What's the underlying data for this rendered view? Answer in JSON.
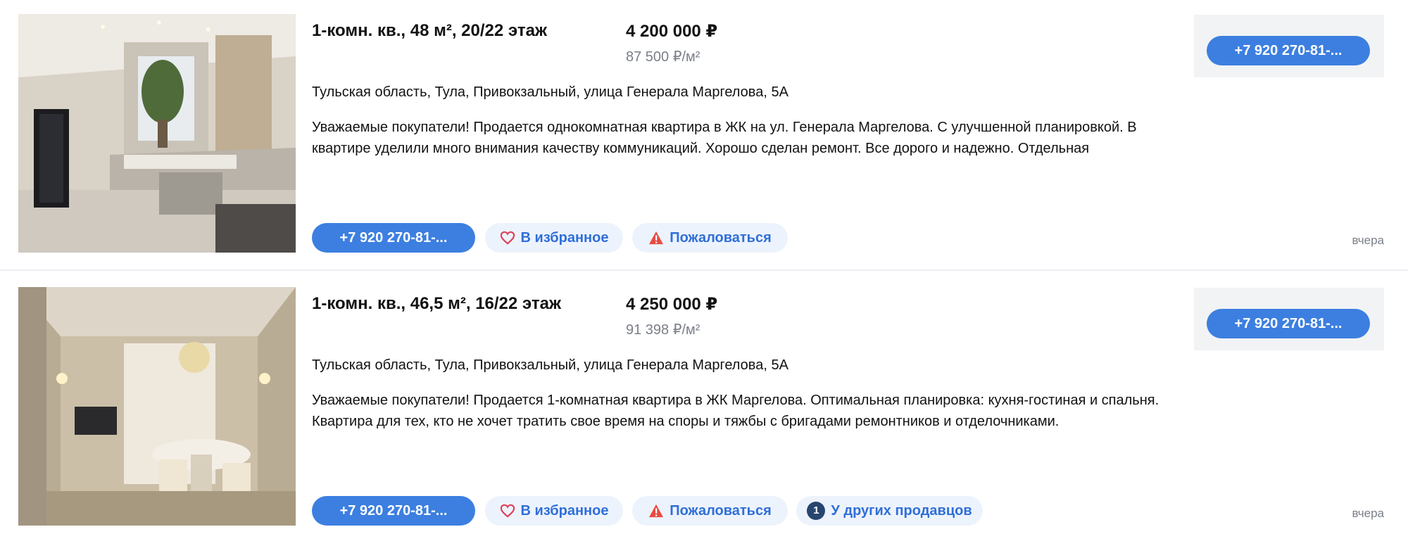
{
  "listings": [
    {
      "title": "1-комн. кв., 48 м², 20/22 этаж",
      "price": "4 200 000 ₽",
      "price_per_m2": "87 500 ₽/м²",
      "address": "Тульская область, Тула, Привокзальный, улица Генерала Маргелова, 5А",
      "description": "Уважаемые покупатели! Продается однокомнатная квартира в ЖК на ул. Генерала Маргелова. С улучшенной планировкой. В квартире уделили много внимания качеству коммуникаций. Хорошо сделан ремонт. Все дорого и надежно. Отдельная",
      "phone_label": "+7 920 270-81-...",
      "favorite_label": "В избранное",
      "complain_label": "Пожаловаться",
      "date": "вчера"
    },
    {
      "title": "1-комн. кв., 46,5 м², 16/22 этаж",
      "price": "4 250 000 ₽",
      "price_per_m2": "91 398 ₽/м²",
      "address": "Тульская область, Тула, Привокзальный, улица Генерала Маргелова, 5А",
      "description": "Уважаемые покупатели! Продается 1-комнатная квартира в ЖК Маргелова. Оптимальная планировка: кухня-гостиная и спальня. Квартира для тех, кто не хочет тратить свое время на споры и тяжбы с бригадами ремонтников и отделочниками.",
      "phone_label": "+7 920 270-81-...",
      "favorite_label": "В избранное",
      "complain_label": "Пожаловаться",
      "other_sellers_count": "1",
      "other_sellers_label": "У других продавцов",
      "date": "вчера"
    }
  ],
  "colors": {
    "primary": "#3c7fe0",
    "pill_bg": "#edf3fc",
    "heart": "#e0405a",
    "warning": "#e84b44"
  }
}
